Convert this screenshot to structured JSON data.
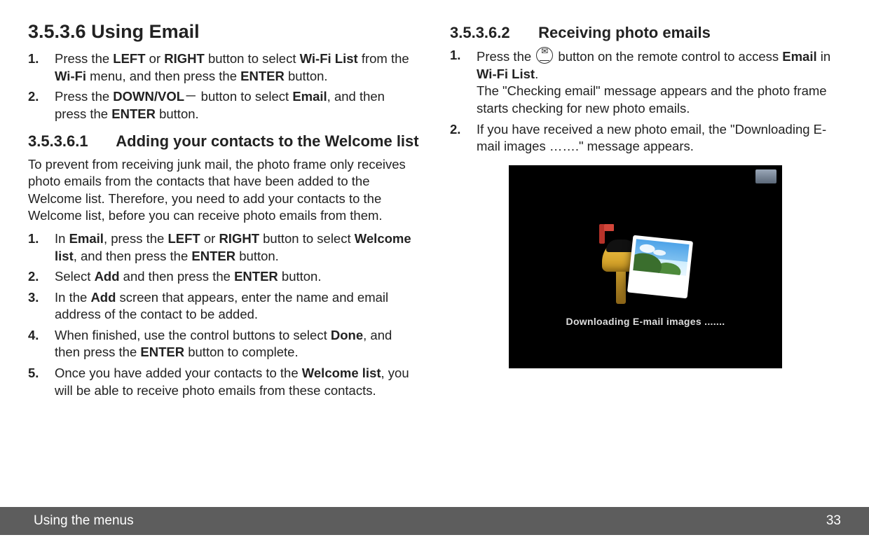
{
  "footer": {
    "title": "Using the menus",
    "page": "33"
  },
  "left": {
    "heading": {
      "num": "3.5.3.6",
      "title": "Using Email"
    },
    "steps1": [
      {
        "n": "1.",
        "parts": [
          "Press the ",
          "LEFT",
          " or ",
          "RIGHT",
          " button to select ",
          "Wi-Fi List",
          " from the ",
          "Wi-Fi",
          " menu, and then press the ",
          "ENTER",
          " button."
        ]
      },
      {
        "n": "2.",
        "parts": [
          "Press the ",
          "DOWN/VOL",
          "－ button to select ",
          "Email",
          ", and then press the ",
          "ENTER",
          " button."
        ]
      }
    ],
    "sub": {
      "num": "3.5.3.6.1",
      "title": "Adding your contacts to the Welcome list"
    },
    "intro": "To prevent from receiving junk mail, the photo frame only receives photo emails from the contacts that have been added to the Welcome list. Therefore, you need to add your contacts to the Welcome list, before you can receive photo emails from them.",
    "steps2": [
      {
        "n": "1.",
        "parts": [
          "In ",
          "Email",
          ", press the ",
          "LEFT",
          " or ",
          "RIGHT",
          " button to select ",
          "Welcome list",
          ", and then press the ",
          "ENTER",
          " button."
        ]
      },
      {
        "n": "2.",
        "parts": [
          "Select ",
          "Add",
          " and then press the ",
          "ENTER",
          " button."
        ]
      },
      {
        "n": "3.",
        "parts": [
          "In the ",
          "Add",
          " screen that appears, enter the name and email address of the contact to be added."
        ]
      },
      {
        "n": "4.",
        "parts": [
          "When finished, use the control buttons to select ",
          "Done",
          ", and then press the ",
          "ENTER",
          " button to complete."
        ]
      },
      {
        "n": "5.",
        "parts": [
          "Once you have added your contacts to the ",
          "Welcome list",
          ", you will be able to receive photo emails from these contacts."
        ]
      }
    ]
  },
  "right": {
    "sub": {
      "num": "3.5.3.6.2",
      "title": "Receiving photo emails"
    },
    "steps": [
      {
        "n": "1.",
        "pre": "Press the ",
        "post_parts": [
          " button on the remote control to access ",
          "Email",
          " in ",
          "Wi-Fi List",
          "."
        ],
        "extra": "The \"Checking email\" message appears and the photo frame starts checking for new photo emails."
      },
      {
        "n": "2.",
        "text": "If you have received a new photo email, the \"Downloading E-mail images …….\" message appears."
      }
    ],
    "screenshot_text": "Downloading E-mail images ......."
  }
}
